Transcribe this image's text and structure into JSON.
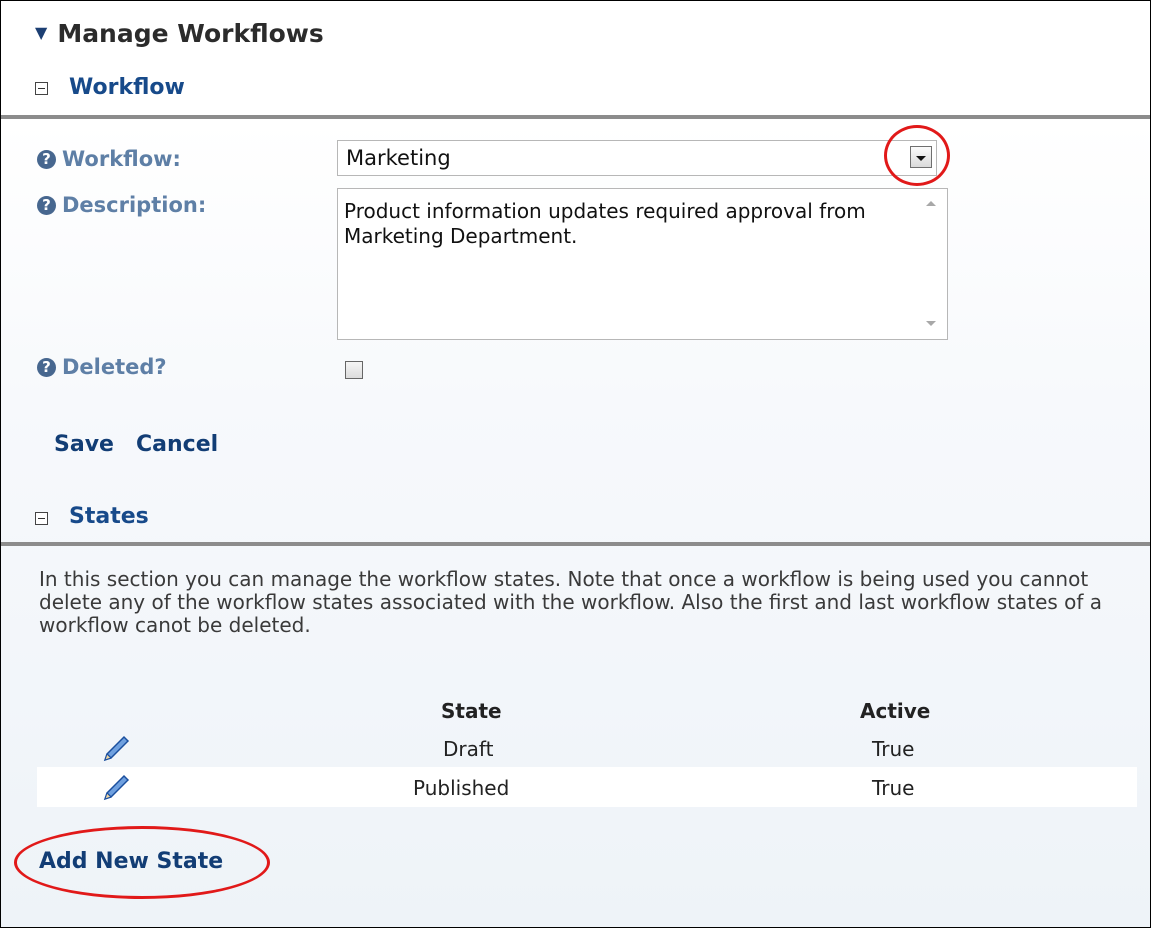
{
  "header": {
    "title": "Manage Workflows"
  },
  "workflow_section": {
    "heading": "Workflow",
    "workflow_label": "Workflow:",
    "workflow_value": "Marketing",
    "description_label": "Description:",
    "description_value": "Product information updates required approval from Marketing Department.",
    "deleted_label": "Deleted?",
    "save_label": "Save",
    "cancel_label": "Cancel"
  },
  "states_section": {
    "heading": "States",
    "description": "In this section you can manage the workflow states. Note that once a workflow is being used you cannot delete any of the workflow states associated with the workflow. Also the first and last workflow states of a workflow canot be deleted.",
    "columns": [
      "State",
      "Active"
    ],
    "rows": [
      {
        "state": "Draft",
        "active": "True"
      },
      {
        "state": "Published",
        "active": "True"
      }
    ],
    "add_label": "Add New State"
  },
  "icons": [
    "collapse-icon",
    "help-icon",
    "dropdown-arrow-icon",
    "edit-pencil-icon"
  ],
  "colors": {
    "accent": "#174a8a",
    "label": "#5e7fa6",
    "highlight": "#e11919"
  }
}
